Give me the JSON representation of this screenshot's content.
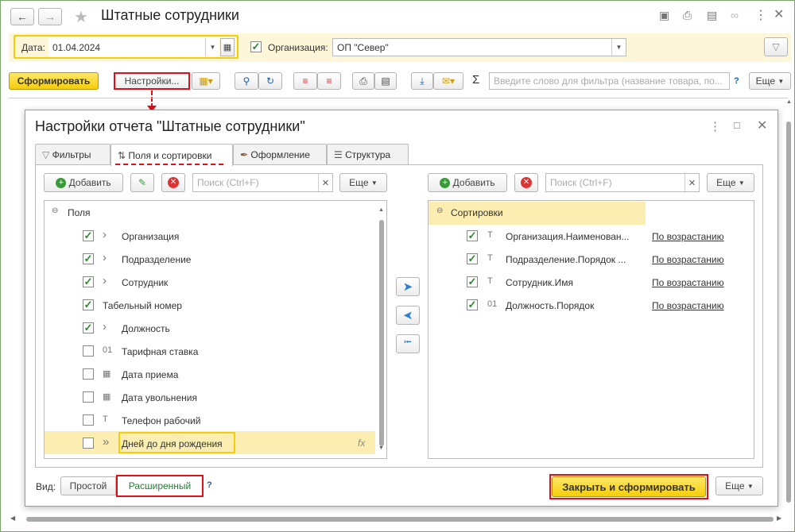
{
  "window": {
    "title": "Штатные сотрудники"
  },
  "toolbar": {
    "date_label": "Дата:",
    "date_value": "01.04.2024",
    "org_label": "Организация:",
    "org_value": "ОП \"Север\"",
    "generate_label": "Сформировать",
    "settings_label": "Настройки...",
    "search_placeholder": "Введите слово для фильтра (название товара, по...",
    "help": "?",
    "more_label": "Еще",
    "sigma": "Σ"
  },
  "dialog": {
    "title": "Настройки отчета \"Штатные сотрудники\"",
    "tabs": [
      {
        "label": "Фильтры"
      },
      {
        "label": "Поля и сортировки"
      },
      {
        "label": "Оформление"
      },
      {
        "label": "Структура"
      }
    ],
    "left": {
      "add_label": "Добавить",
      "search_placeholder": "Поиск (Ctrl+F)",
      "more_label": "Еще",
      "root_label": "Поля",
      "items": [
        {
          "label": "Организация",
          "checked": true,
          "icon": ">"
        },
        {
          "label": "Подразделение",
          "checked": true,
          "icon": ">"
        },
        {
          "label": "Сотрудник",
          "checked": true,
          "icon": ">"
        },
        {
          "label": "Табельный номер",
          "checked": true,
          "icon": ""
        },
        {
          "label": "Должность",
          "checked": true,
          "icon": ">"
        },
        {
          "label": "Тарифная ставка",
          "checked": false,
          "icon": "01"
        },
        {
          "label": "Дата приема",
          "checked": false,
          "icon": "cal"
        },
        {
          "label": "Дата увольнения",
          "checked": false,
          "icon": "cal"
        },
        {
          "label": "Телефон рабочий",
          "checked": false,
          "icon": "T"
        },
        {
          "label": "Дней до дня рождения",
          "checked": false,
          "icon": ">>",
          "fx": "fx"
        }
      ]
    },
    "right": {
      "add_label": "Добавить",
      "search_placeholder": "Поиск (Ctrl+F)",
      "more_label": "Еще",
      "root_label": "Сортировки",
      "items": [
        {
          "label": "Организация.Наименован...",
          "icon": "T",
          "order": "По возрастанию"
        },
        {
          "label": "Подразделение.Порядок ...",
          "icon": "T",
          "order": "По возрастанию"
        },
        {
          "label": "Сотрудник.Имя",
          "icon": "T",
          "order": "По возрастанию"
        },
        {
          "label": "Должность.Порядок",
          "icon": "01",
          "order": "По возрастанию"
        }
      ]
    },
    "view_label": "Вид:",
    "view_simple": "Простой",
    "view_extended": "Расширенный",
    "help": "?",
    "close_generate_label": "Закрыть и сформировать",
    "more_label": "Еще"
  },
  "colors": {
    "accent": "#f5cd0a",
    "highlight": "#fbeeb0",
    "green_check": "#2a8a2a",
    "red_annotation": "#e0101a"
  }
}
